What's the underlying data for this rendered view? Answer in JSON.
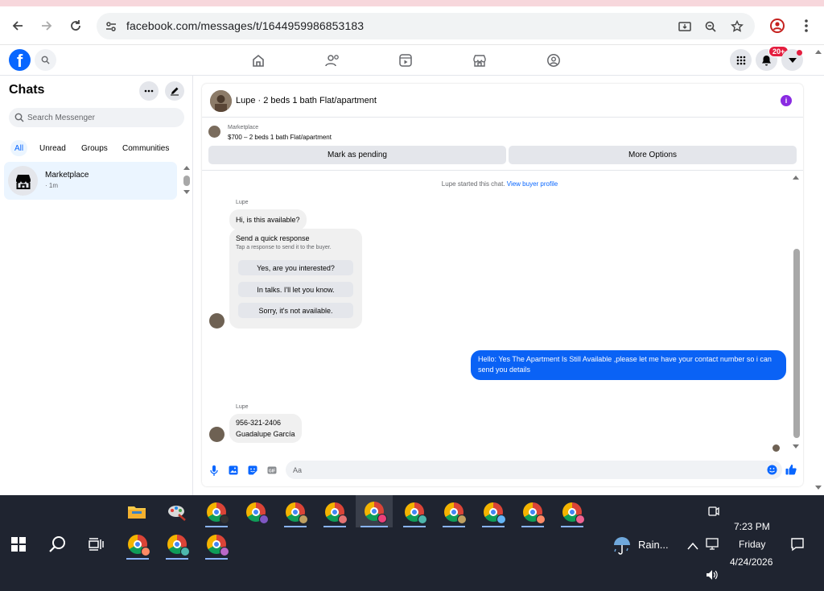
{
  "browser": {
    "url": "facebook.com/messages/t/1644959986853183",
    "icons": [
      "back-icon",
      "forward-icon",
      "reload-icon",
      "site-info-icon",
      "install-icon",
      "zoom-icon",
      "bookmark-star-icon",
      "profile-icon",
      "menu-kebab-icon"
    ]
  },
  "fb_nav": {
    "logo": "f",
    "notification_badge": "20+",
    "icons": [
      "home-icon",
      "friends-icon",
      "video-icon",
      "marketplace-icon",
      "groups-icon",
      "apps-grid-icon",
      "bell-icon",
      "account-chevron-icon"
    ]
  },
  "chats": {
    "title": "Chats",
    "search_placeholder": "Search Messenger",
    "filters": [
      "All",
      "Unread",
      "Groups",
      "Communities"
    ],
    "active_filter": "All",
    "items": [
      {
        "name": "Marketplace",
        "time": "· 1m"
      }
    ]
  },
  "conversation": {
    "title": "Lupe · 2 beds 1 bath Flat/apartment",
    "marketplace_label": "Marketplace",
    "listing": "$700 – 2 beds 1 bath Flat/apartment",
    "buttons": {
      "pending": "Mark as pending",
      "more": "More Options"
    },
    "started_text": "Lupe started this chat.",
    "view_profile": "View buyer profile",
    "sender_name": "Lupe",
    "msg1": "Hi, is this available?",
    "quick_title": "Send a quick response",
    "quick_sub": "Tap a response to send it to the buyer.",
    "quick_options": [
      "Yes, are you interested?",
      "In talks. I'll let you know.",
      "Sorry, it's not available."
    ],
    "outgoing": "Hello: Yes The Apartment Is Still Available ,please let me have your contact number so i can send you details",
    "reply_line1": "956-321-2406",
    "reply_line2": "Guadalupe García",
    "composer_placeholder": "Aa"
  },
  "colors": {
    "accent": "#0866ff",
    "outgoing_bubble": "#0a62f5",
    "taskbar": "#1f2430",
    "badge": "#e41e3f"
  },
  "taskbar": {
    "weather": "Rain...",
    "time": "7:23 PM",
    "day": "Friday",
    "date": "4/24/2026"
  }
}
